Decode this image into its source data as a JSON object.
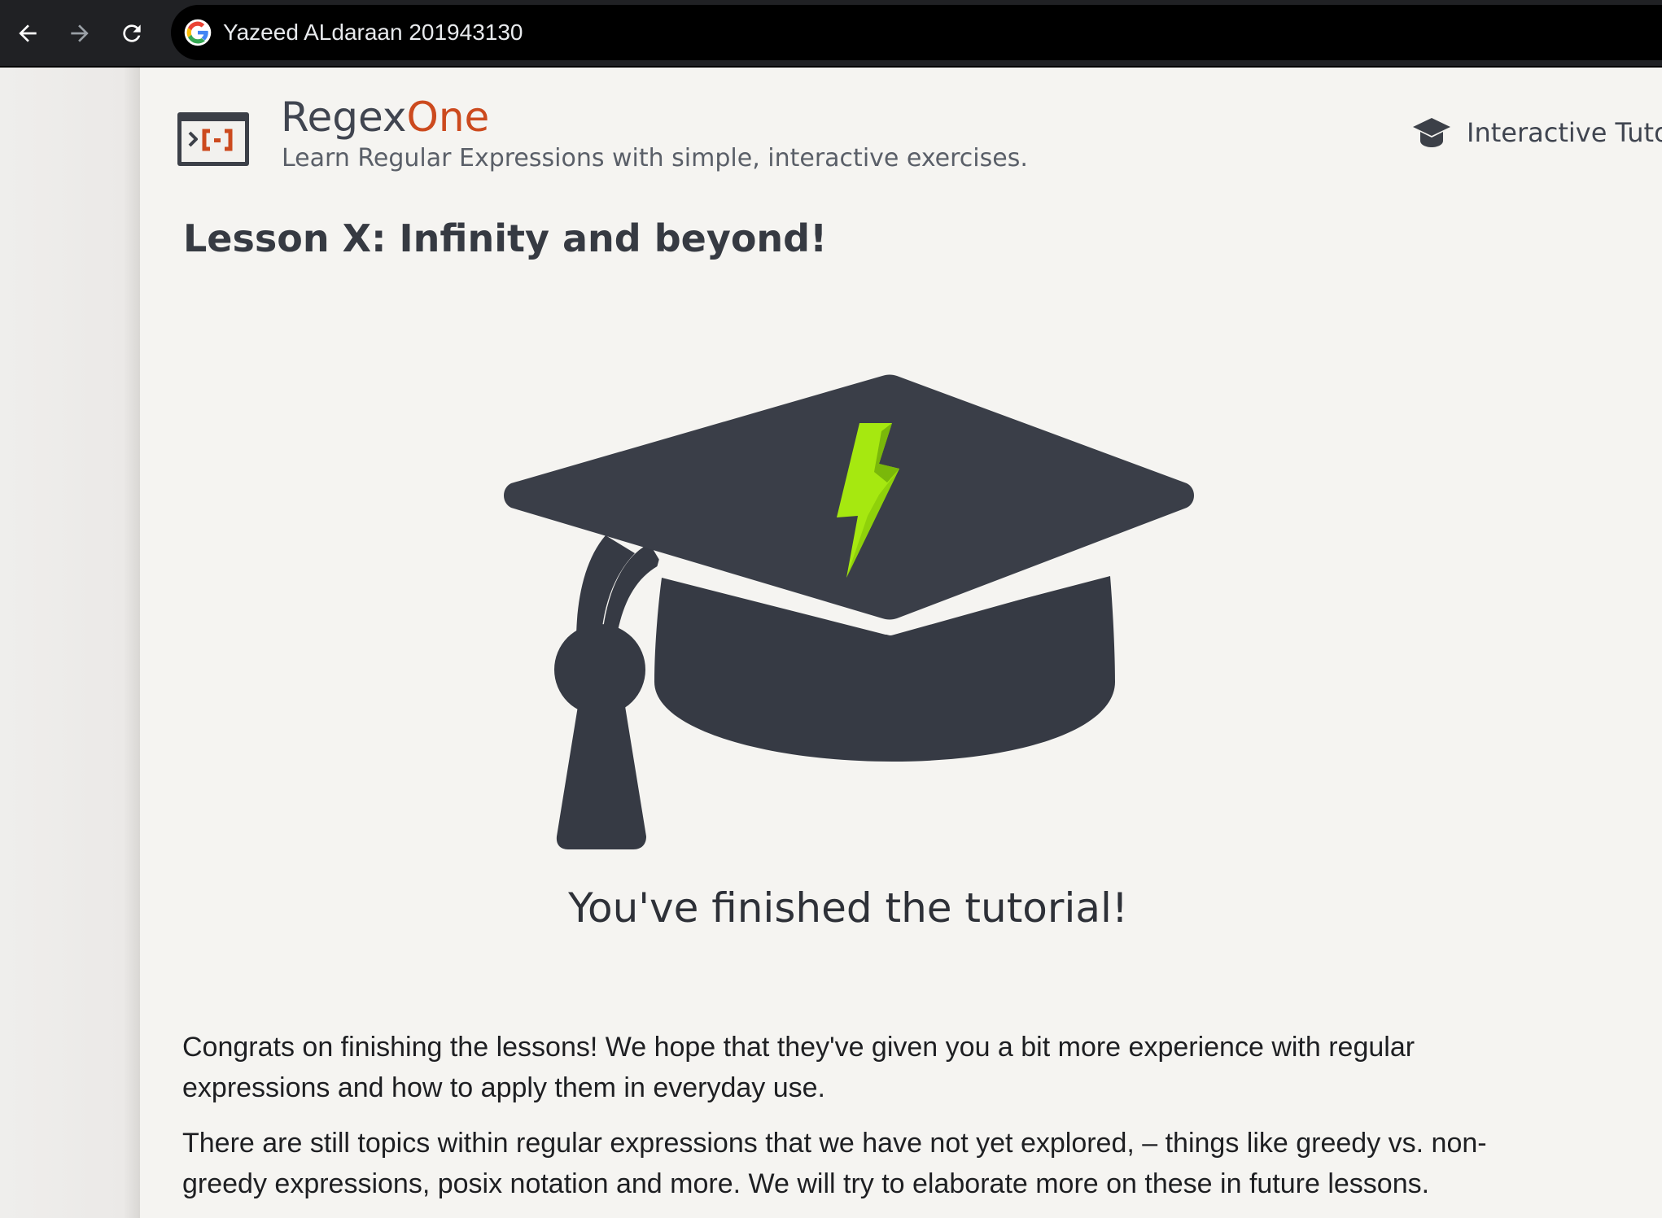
{
  "browser": {
    "back_icon": "arrow-left-icon",
    "forward_icon": "arrow-right-icon",
    "reload_icon": "reload-icon",
    "site_icon": "google-icon",
    "omnibox_text": "Yazeed ALdaraan 201943130"
  },
  "header": {
    "brand_main": "Regex",
    "brand_accent": "One",
    "tagline": "Learn Regular Expressions with simple, interactive exercises.",
    "nav_link": "Interactive Tuto",
    "nav_icon": "graduation-cap-icon"
  },
  "lesson": {
    "title": "Lesson X: Infinity and beyond!",
    "illustration_icon": "graduation-cap-lightning-icon",
    "finished_text": "You've finished the tutorial!",
    "paragraphs": [
      "Congrats on finishing the lessons! We hope that they've given you a bit more experience with regular expressions and how to apply them in everyday use.",
      "There are still topics within regular expressions that we have not yet explored, – things like greedy vs. non-greedy expressions, posix notation and more. We will try to elaborate more on these in future lessons."
    ]
  },
  "colors": {
    "accent": "#cc4a1e",
    "hat": "#363a44",
    "bolt": "#9be000",
    "page_bg": "#f5f4f1",
    "chrome_bg": "#202124"
  }
}
